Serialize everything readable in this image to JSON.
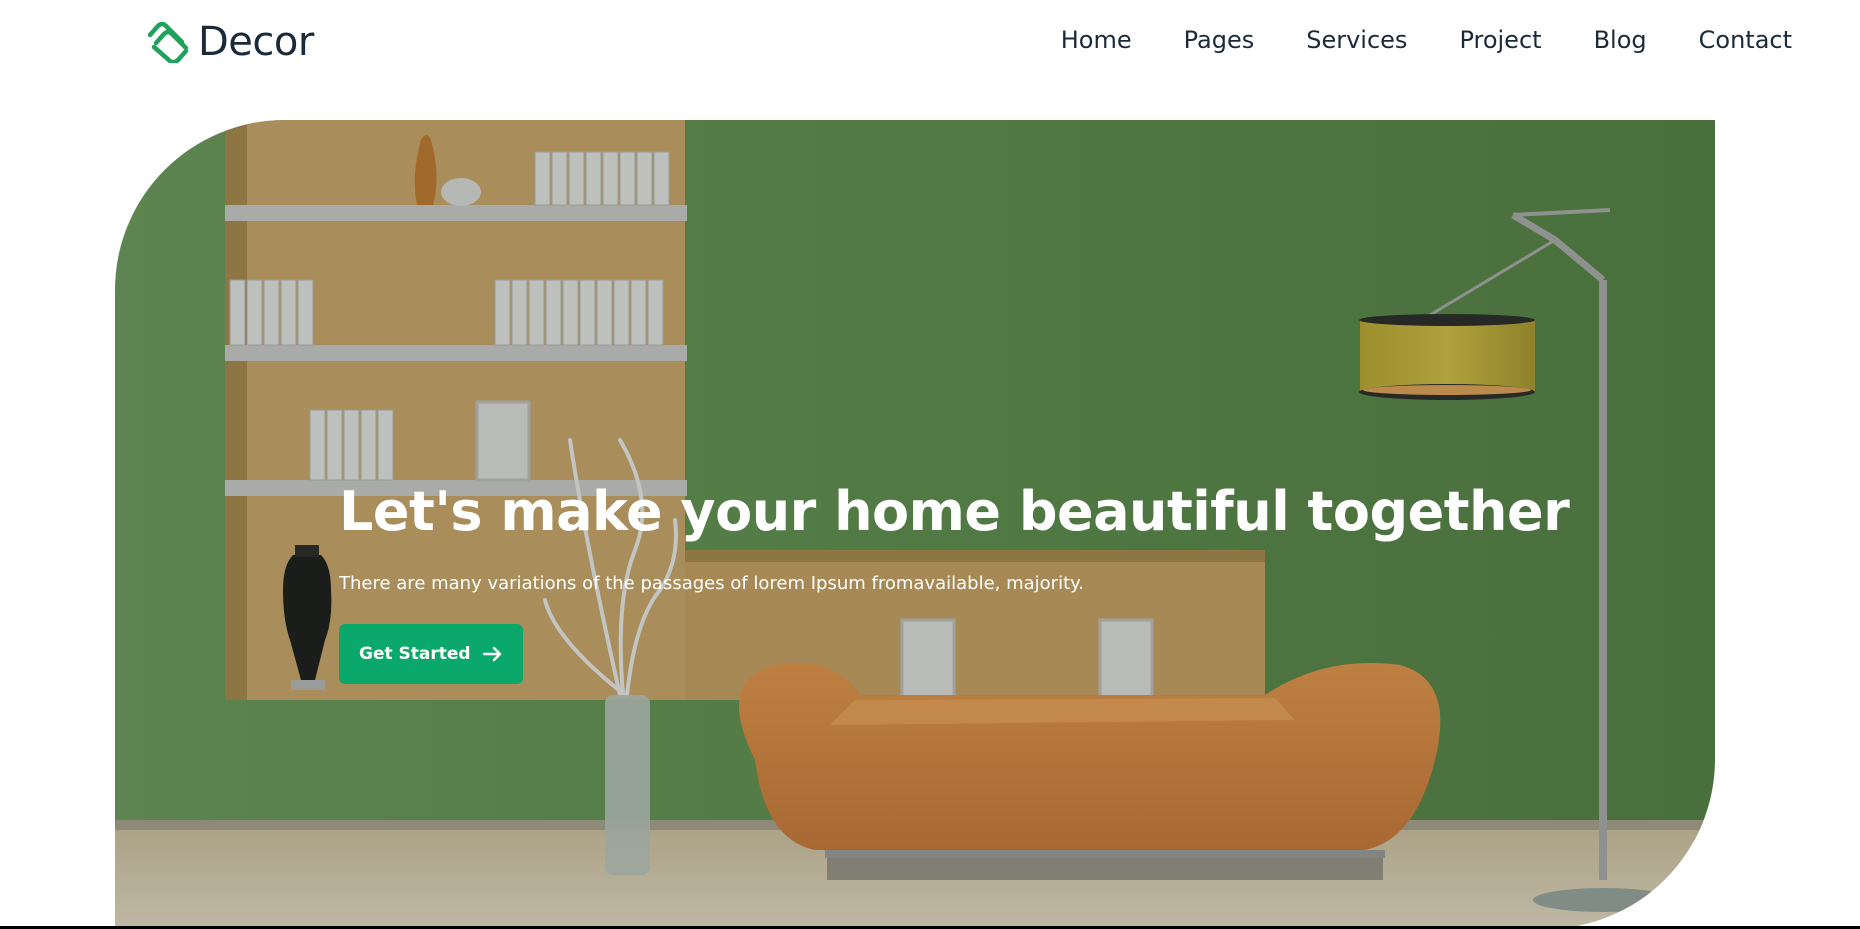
{
  "brand": {
    "name": "Decor",
    "icon": "decor-logo-icon",
    "accent_color": "#0aa86a"
  },
  "nav": {
    "items": [
      {
        "label": "Home"
      },
      {
        "label": "Pages"
      },
      {
        "label": "Services"
      },
      {
        "label": "Project"
      },
      {
        "label": "Blog"
      },
      {
        "label": "Contact"
      }
    ]
  },
  "hero": {
    "title": "Let's make your home beautiful together",
    "subtitle": "There are many variations of the passages of lorem Ipsum fromavailable, majority.",
    "cta_label": "Get Started",
    "cta_icon": "arrow-right-icon",
    "image": "green-living-room-photo",
    "colors": {
      "wall": "#5b8a4d",
      "shelf_niche": "#caa46a",
      "sofa": "#d98a45",
      "lamp_shade": "#c8b23c",
      "floor": "#d9cbb4"
    }
  }
}
